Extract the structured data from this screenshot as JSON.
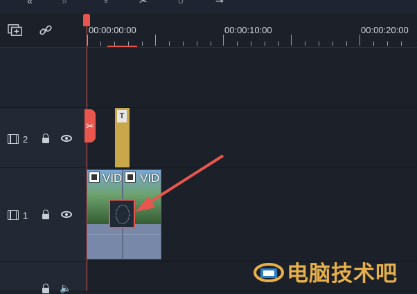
{
  "ruler": {
    "times": [
      "00:00:00:00",
      "00:00:10:00",
      "00:00:20:00"
    ]
  },
  "tracks": [
    {
      "name": "track-2",
      "label": "2"
    },
    {
      "name": "track-1",
      "label": "1"
    }
  ],
  "clips": {
    "video_label": "VID"
  },
  "watermark": {
    "text": "电脑技术吧"
  },
  "colors": {
    "playhead": "#e8564e",
    "title_clip": "#c8a84a",
    "video_clip": "#7d8ca8",
    "watermark": "#e8b04a"
  }
}
